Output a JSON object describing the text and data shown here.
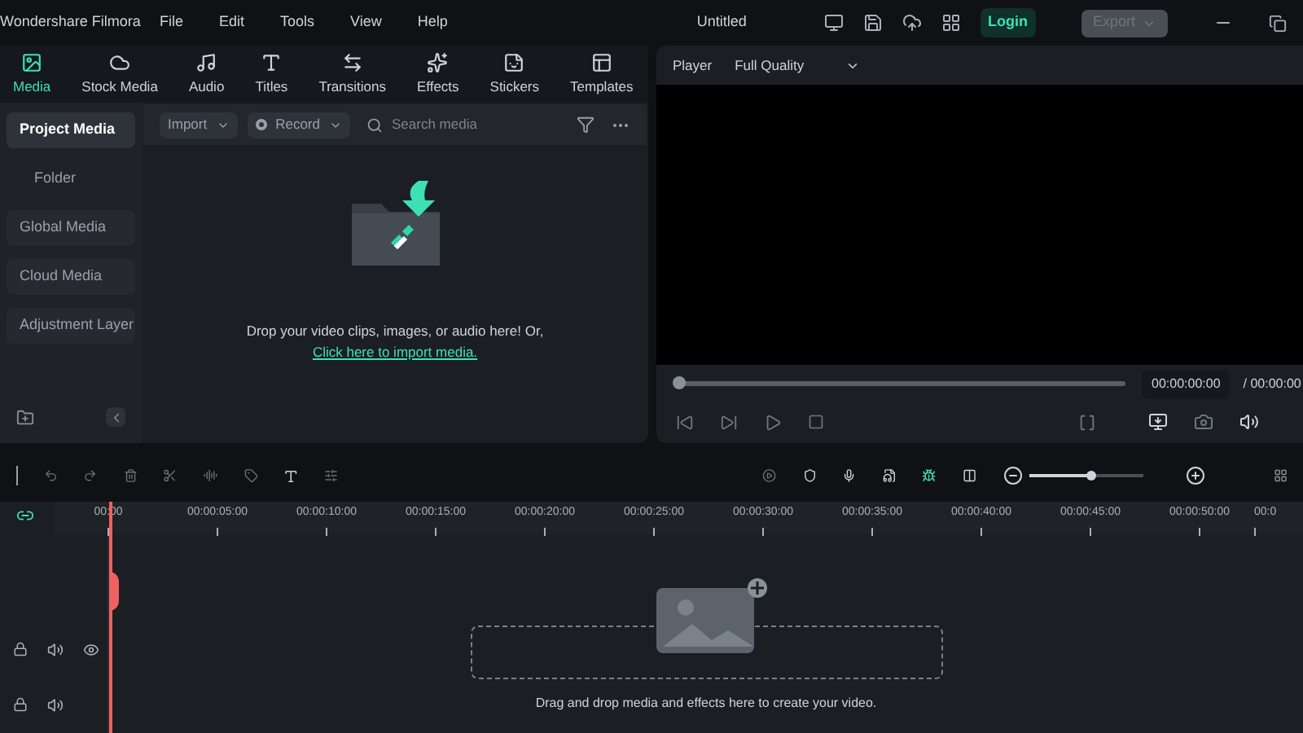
{
  "app_title": "Wondershare Filmora",
  "menu": [
    "File",
    "Edit",
    "Tools",
    "View",
    "Help"
  ],
  "document_title": "Untitled",
  "login": "Login",
  "export": {
    "label": "Export",
    "disabled": true
  },
  "tabs": [
    {
      "label": "Media",
      "selected": true
    },
    {
      "label": "Stock Media",
      "selected": false
    },
    {
      "label": "Audio",
      "selected": false
    },
    {
      "label": "Titles",
      "selected": false
    },
    {
      "label": "Transitions",
      "selected": false
    },
    {
      "label": "Effects",
      "selected": false
    },
    {
      "label": "Stickers",
      "selected": false
    },
    {
      "label": "Templates",
      "selected": false
    }
  ],
  "sidebar": {
    "items": [
      {
        "label": "Project Media",
        "selected": true,
        "children": [
          {
            "label": "Folder",
            "selected": false
          }
        ]
      },
      {
        "label": "Global Media",
        "selected": false
      },
      {
        "label": "Cloud Media",
        "selected": false
      },
      {
        "label": "Adjustment Layer",
        "selected": false
      }
    ]
  },
  "media_toolbar": {
    "import": "Import",
    "record": "Record",
    "search": {
      "placeholder": "Search media"
    }
  },
  "drop_zone": {
    "text": "Drop your video clips, images, or audio here! Or,",
    "link": "Click here to import media."
  },
  "player": {
    "label": "Player",
    "quality": "Full Quality",
    "progress": {
      "level": 0
    },
    "current_time": "00:00:00:00",
    "total_time": "/ 00:00:00"
  },
  "zoom": {
    "level": 0.55
  },
  "ruler": [
    "00:00",
    "00:00:05:00",
    "00:00:10:00",
    "00:00:15:00",
    "00:00:20:00",
    "00:00:25:00",
    "00:00:30:00",
    "00:00:35:00",
    "00:00:40:00",
    "00:00:45:00",
    "00:00:50:00",
    "00:0"
  ],
  "timeline_hint": "Drag and drop media and effects here to create your video."
}
